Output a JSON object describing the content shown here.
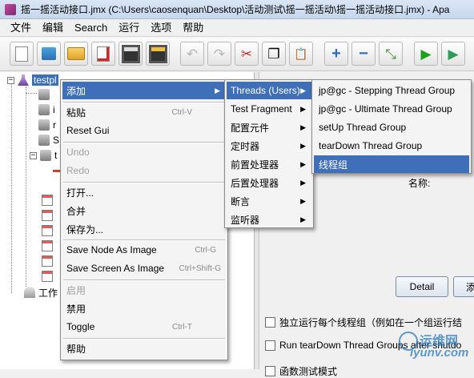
{
  "window": {
    "title": "摇一摇活动接口.jmx (C:\\Users\\caosenquan\\Desktop\\活动测试\\摇一摇活动\\摇一摇活动接口.jmx) - Apa"
  },
  "menubar": [
    "文件",
    "编辑",
    "Search",
    "运行",
    "选项",
    "帮助"
  ],
  "toolbar": {
    "icons": [
      "new-icon",
      "templates-icon",
      "open-icon",
      "close-icon",
      "save-icon",
      "save-as-icon",
      "undo-icon",
      "redo-icon",
      "cut-icon",
      "copy-icon",
      "paste-icon",
      "expand-icon",
      "collapse-icon",
      "toggle-icon",
      "start-icon",
      "start-no-pause-icon"
    ],
    "glyphs": {
      "undo": "↶",
      "redo": "↷",
      "cut": "✂",
      "copy": "❐",
      "paste": "📋",
      "expand": "+",
      "collapse": "−",
      "toggle": "⤡",
      "start": "▶",
      "start_no_pause": "▶"
    }
  },
  "tree": {
    "root_label": "testpl",
    "root_expander": "−",
    "second_expander": "−",
    "group_fragment_labels": [
      "i",
      "r",
      "S",
      "t"
    ],
    "workbench_label": "工作"
  },
  "context_menu": {
    "items": [
      {
        "label": "添加",
        "submenu": true
      },
      {
        "label": "粘贴",
        "accel": "Ctrl-V"
      },
      {
        "label": "Reset Gui"
      },
      {
        "label": "Undo",
        "disabled": true
      },
      {
        "label": "Redo",
        "disabled": true
      },
      {
        "label": "打开..."
      },
      {
        "label": "合并"
      },
      {
        "label": "保存为..."
      },
      {
        "label": "Save Node As Image",
        "accel": "Ctrl-G"
      },
      {
        "label": "Save Screen As Image",
        "accel": "Ctrl+Shift-G"
      },
      {
        "label": "启用",
        "disabled": true
      },
      {
        "label": "禁用"
      },
      {
        "label": "Toggle",
        "accel": "Ctrl-T"
      },
      {
        "label": "帮助"
      }
    ]
  },
  "add_submenu": {
    "items": [
      {
        "label": "Threads (Users)"
      },
      {
        "label": "Test Fragment"
      },
      {
        "label": "配置元件"
      },
      {
        "label": "定时器"
      },
      {
        "label": "前置处理器"
      },
      {
        "label": "后置处理器"
      },
      {
        "label": "断言"
      },
      {
        "label": "监听器"
      }
    ],
    "arrow": "▶"
  },
  "threads_submenu": {
    "items": [
      {
        "label": "jp@gc - Stepping Thread Group"
      },
      {
        "label": "jp@gc - Ultimate Thread Group"
      },
      {
        "label": "setUp Thread Group"
      },
      {
        "label": "tearDown Thread Group"
      },
      {
        "label": "线程组"
      }
    ]
  },
  "right_panel": {
    "name_label": "名称:",
    "detail_button": "Detail",
    "add_button_fragment": "添",
    "checkbox_1": "独立运行每个线程组（例如在一个组运行结",
    "checkbox_2": "Run tearDown Thread Groups after shutdo",
    "checkbox_3": "函数测试模式"
  },
  "watermark": {
    "line1": "运维网",
    "line2": "iyunv.com"
  },
  "colors": {
    "menu_highlight": "#3f6fb8",
    "tree_selection": "#3b6fb6",
    "disabled_text": "#a0a0a0"
  }
}
